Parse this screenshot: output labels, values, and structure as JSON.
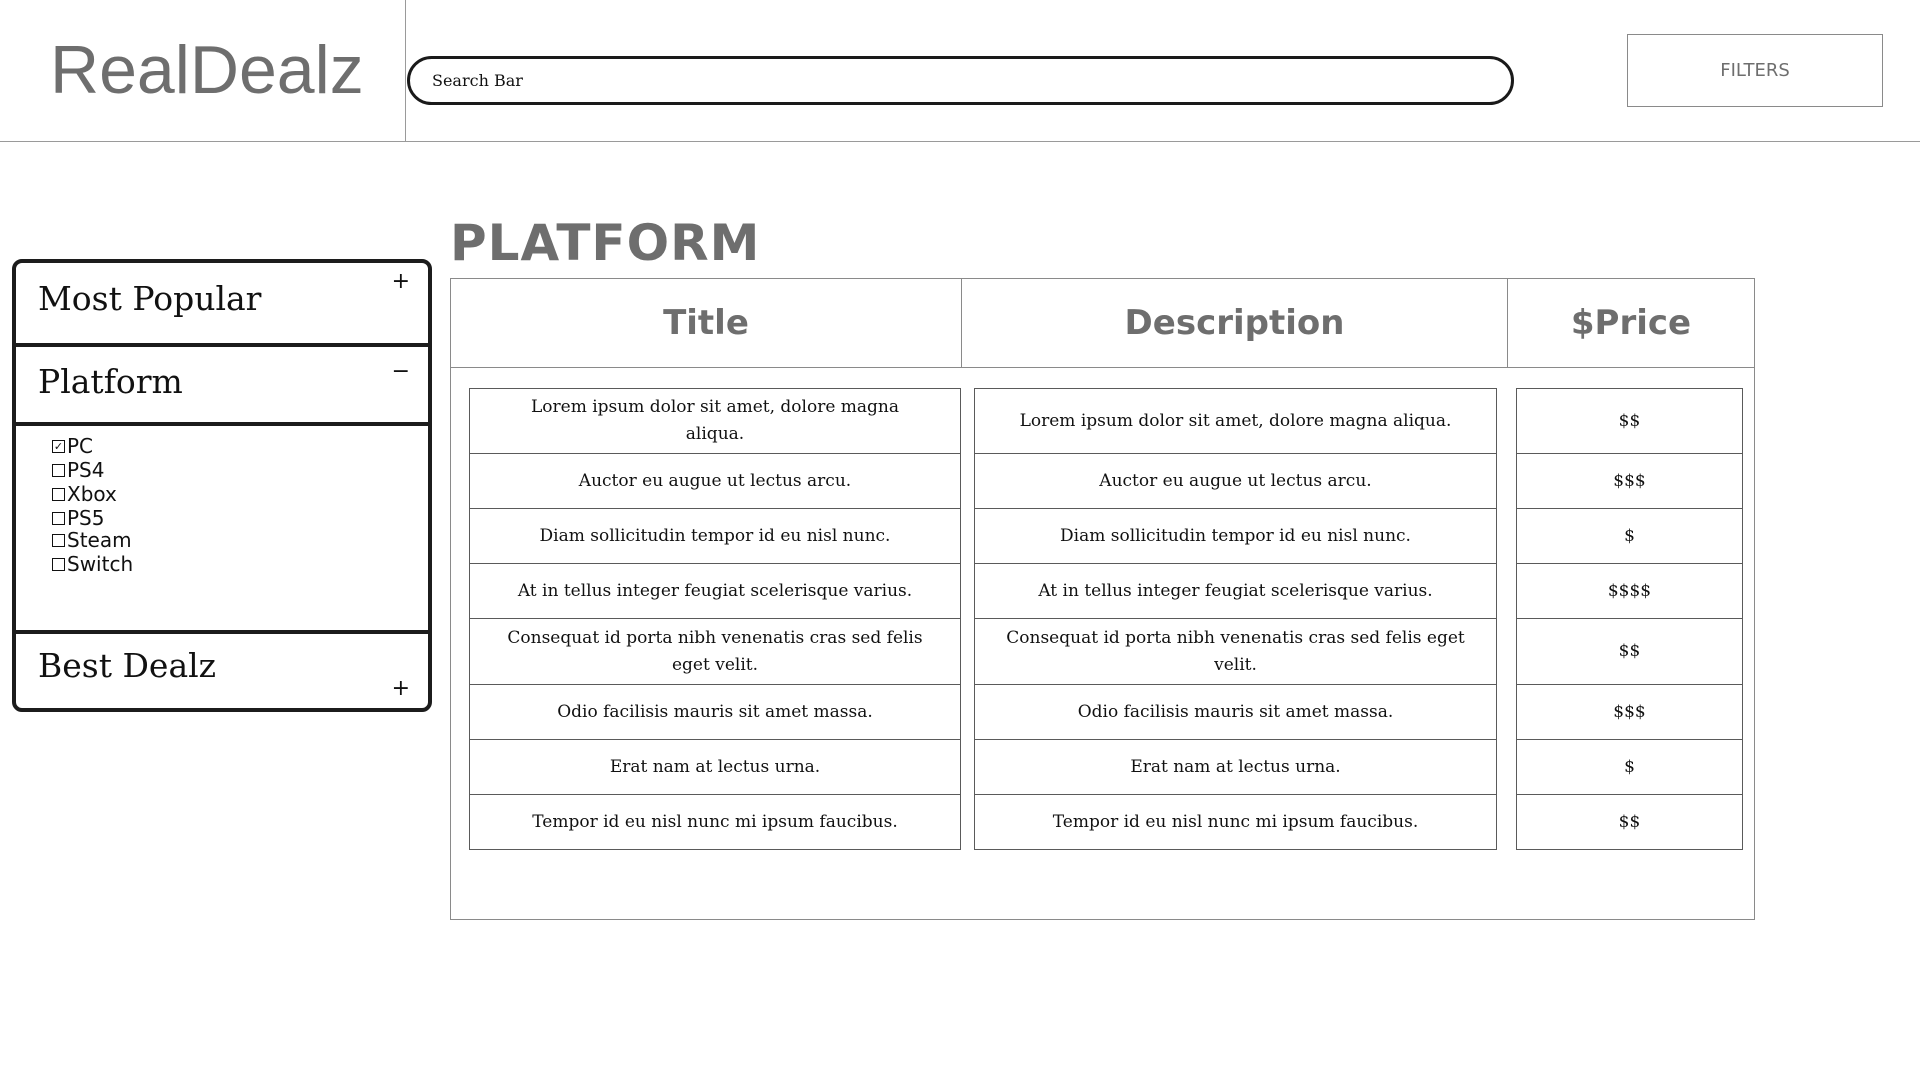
{
  "header": {
    "logo": "RealDealz",
    "search": {
      "placeholder": "Search Bar",
      "value": ""
    },
    "filters_label": "FILTERS"
  },
  "sidebar": {
    "sections": [
      {
        "label": "Most Popular",
        "toggle": "+"
      },
      {
        "label": "Platform",
        "toggle": "−"
      },
      {
        "label": "Best Dealz",
        "toggle": "+"
      }
    ],
    "platforms": [
      {
        "label": "PC",
        "checked": true
      },
      {
        "label": "PS4",
        "checked": false
      },
      {
        "label": "Xbox",
        "checked": false
      },
      {
        "label": "PS5",
        "checked": false
      },
      {
        "label": "Steam",
        "checked": false
      },
      {
        "label": "Switch",
        "checked": false
      }
    ]
  },
  "main": {
    "section_title": "PLATFORM",
    "columns": {
      "title": "Title",
      "description": "Description",
      "price": "$Price"
    },
    "rows": [
      {
        "title": "Lorem ipsum dolor sit amet, dolore magna aliqua.",
        "description": "Lorem ipsum dolor sit amet, dolore magna aliqua.",
        "price": "$$"
      },
      {
        "title": "Auctor eu augue ut lectus arcu.",
        "description": "Auctor eu augue ut lectus arcu.",
        "price": "$$$"
      },
      {
        "title": "Diam sollicitudin tempor id eu nisl nunc.",
        "description": "Diam sollicitudin tempor id eu nisl nunc.",
        "price": "$"
      },
      {
        "title": "At in tellus integer feugiat scelerisque varius.",
        "description": "At in tellus integer feugiat scelerisque varius.",
        "price": "$$$$"
      },
      {
        "title": "Consequat id porta nibh venenatis cras sed felis eget velit.",
        "description": "Consequat id porta nibh venenatis cras sed felis eget velit.",
        "price": "$$"
      },
      {
        "title": "Odio facilisis mauris sit amet massa.",
        "description": "Odio facilisis mauris sit amet massa.",
        "price": "$$$"
      },
      {
        "title": "Erat nam at lectus urna.",
        "description": "Erat nam at lectus urna.",
        "price": "$"
      },
      {
        "title": "Tempor id eu nisl nunc mi ipsum faucibus.",
        "description": "Tempor id eu nisl nunc mi ipsum faucibus.",
        "price": "$$"
      }
    ]
  }
}
